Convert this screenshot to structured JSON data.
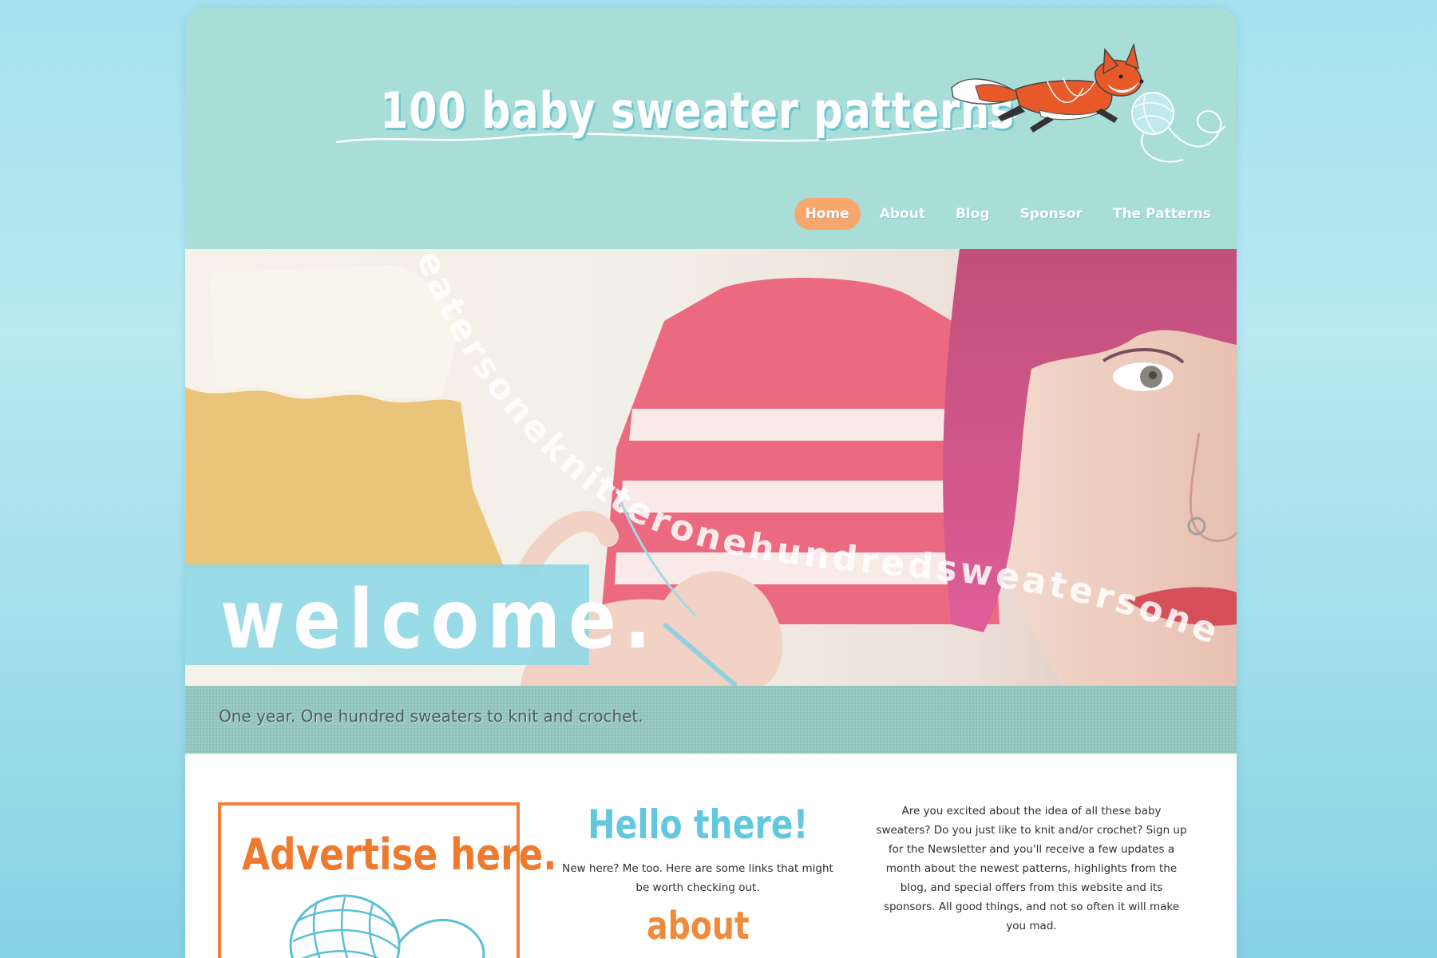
{
  "header": {
    "site_title": "100 baby sweater patterns"
  },
  "nav": {
    "items": [
      {
        "label": "Home",
        "active": true
      },
      {
        "label": "About",
        "active": false
      },
      {
        "label": "Blog",
        "active": false
      },
      {
        "label": "Sponsor",
        "active": false
      },
      {
        "label": "The Patterns",
        "active": false
      }
    ]
  },
  "hero": {
    "welcome": "welcome.",
    "watermark_text": "eatersoneknitteronehundredsweatersone"
  },
  "tagline": "One year. One hundred sweaters to knit and crochet.",
  "ad": {
    "title": "Advertise here."
  },
  "hello": {
    "title": "Hello there!",
    "text": "New here? Me too. Here are some links that might be worth checking out.",
    "about_link": "about"
  },
  "newsletter": {
    "text": "Are you excited about the idea of all these baby sweaters? Do you just like to knit and/or crochet? Sign up for the Newsletter and you'll receive a few updates a month about the newest patterns, highlights from the blog, and special offers from this website and its sponsors. All good things, and not so often it will make you mad."
  },
  "colors": {
    "header_bg": "#a8ddd8",
    "nav_active": "#f7a66c",
    "welcome_box": "#8cd7e6",
    "tagline_band": "#93c7c1",
    "ad_orange": "#ee7a2f",
    "hello_blue": "#62c8dd",
    "about_orange": "#f08a3c"
  },
  "icons": [
    "fox-illustration",
    "yarn-ball-icon"
  ]
}
